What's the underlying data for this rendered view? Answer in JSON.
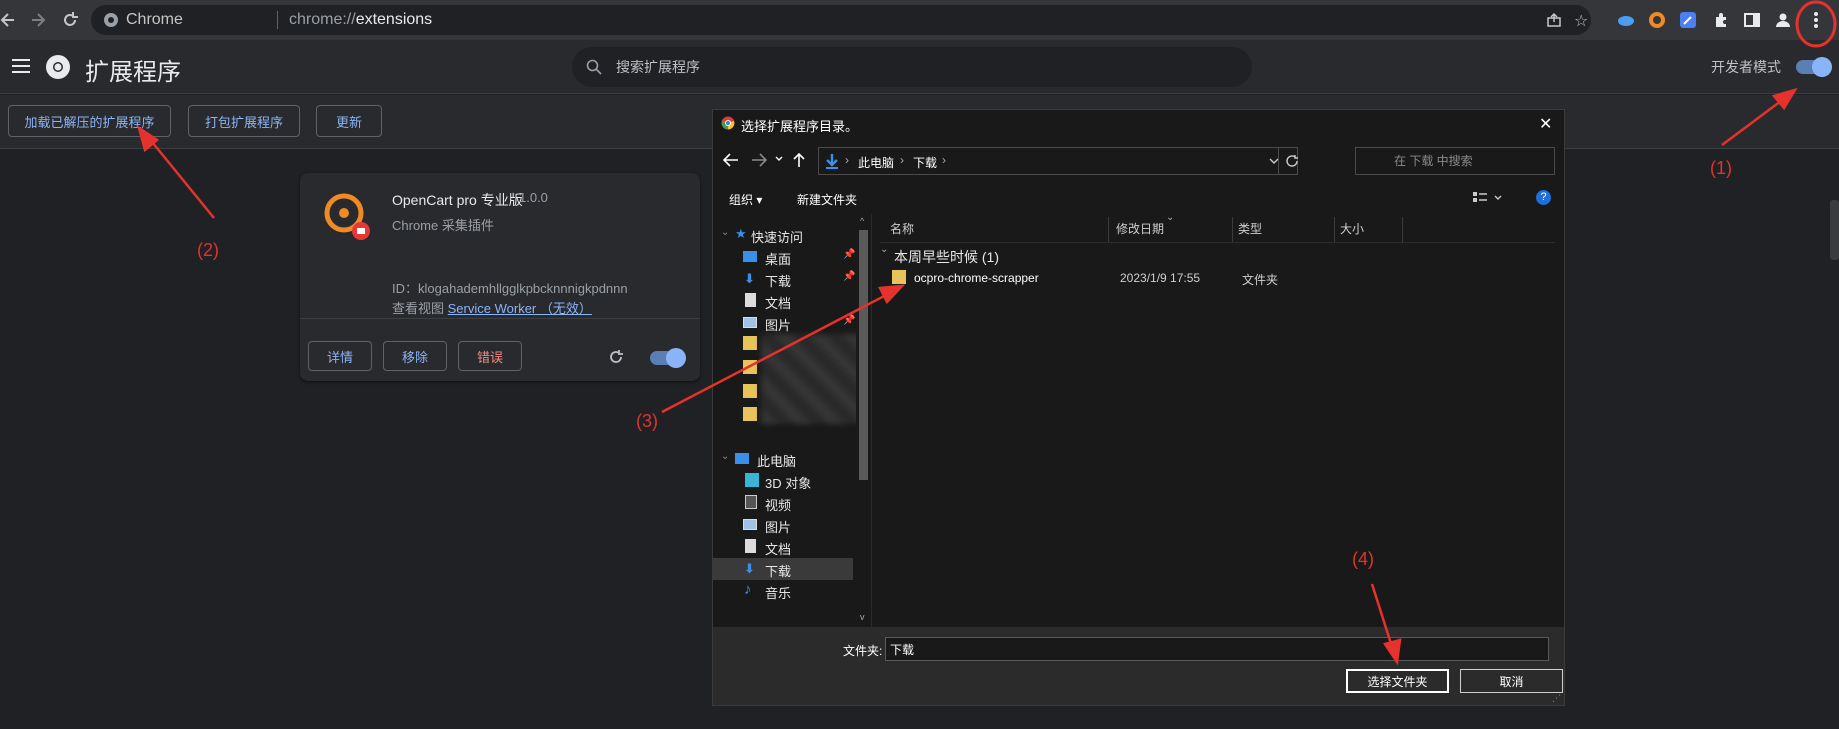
{
  "browser": {
    "brand": "Chrome",
    "url_scheme": "chrome://",
    "url_host": "extensions"
  },
  "header": {
    "title": "扩展程序",
    "search_placeholder": "搜索扩展程序",
    "dev_mode_label": "开发者模式"
  },
  "toolbar": {
    "load_unpacked": "加载已解压的扩展程序",
    "pack": "打包扩展程序",
    "update": "更新"
  },
  "extension": {
    "name": "OpenCart pro 专业版",
    "version": "1.0.0",
    "description": "Chrome 采集插件",
    "id_label": "ID：",
    "id": "klogahademhllgglkpbcknnnigkpdnnn",
    "views_label": "查看视图",
    "views_link": "Service Worker （无效）",
    "details": "详情",
    "remove": "移除",
    "errors": "错误"
  },
  "dialog": {
    "title": "选择扩展程序目录。",
    "path": [
      "此电脑",
      "下载"
    ],
    "search_placeholder": "在 下载 中搜索",
    "organize": "组织",
    "new_folder": "新建文件夹",
    "nav_items": {
      "quick_access": "快速访问",
      "desktop": "桌面",
      "downloads": "下载",
      "documents": "文档",
      "pictures": "图片",
      "this_pc": "此电脑",
      "objects3d": "3D 对象",
      "videos": "视频",
      "pictures2": "图片",
      "documents2": "文档",
      "downloads2": "下载",
      "music": "音乐"
    },
    "columns": {
      "name": "名称",
      "date": "修改日期",
      "type": "类型",
      "size": "大小"
    },
    "group_label": "本周早些时候 (1)",
    "file": {
      "name": "ocpro-chrome-scrapper",
      "date": "2023/1/9 17:55",
      "type": "文件夹"
    },
    "folder_label": "文件夹:",
    "folder_value": "下载",
    "select_btn": "选择文件夹",
    "cancel_btn": "取消"
  },
  "annotations": {
    "a1": "(1)",
    "a2": "(2)",
    "a3": "(3)",
    "a4": "(4)"
  },
  "colors": {
    "accent": "#8ab4f8",
    "annotation": "#e5322d",
    "folder": "#e8c35a"
  }
}
